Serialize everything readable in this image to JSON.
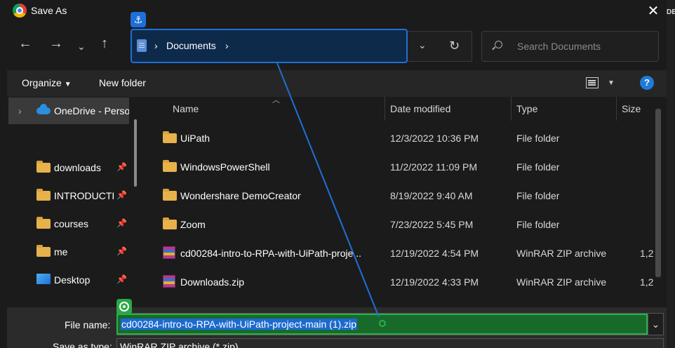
{
  "window": {
    "title": "Save As",
    "close_icon": "close-icon",
    "edge_text": "DE"
  },
  "nav": {
    "back_icon": "arrow-left-icon",
    "forward_icon": "arrow-right-icon",
    "recent_icon": "chevron-down-icon",
    "up_icon": "arrow-up-icon",
    "breadcrumb": [
      "Documents"
    ],
    "refresh_icon": "refresh-icon",
    "search_placeholder": "Search Documents"
  },
  "toolbar": {
    "organize": "Organize",
    "new_folder": "New folder"
  },
  "sidebar": {
    "items": [
      {
        "label": "OneDrive - Perso",
        "icon": "onedrive-icon",
        "pinned": false
      },
      {
        "label": "downloads",
        "icon": "folder-icon",
        "pinned": true
      },
      {
        "label": "INTRODUCTI",
        "icon": "folder-icon",
        "pinned": true
      },
      {
        "label": "courses",
        "icon": "folder-icon",
        "pinned": true
      },
      {
        "label": "me",
        "icon": "folder-icon",
        "pinned": true
      },
      {
        "label": "Desktop",
        "icon": "desktop-icon",
        "pinned": true
      }
    ]
  },
  "columns": {
    "name": "Name",
    "date": "Date modified",
    "type": "Type",
    "size": "Size"
  },
  "files": [
    {
      "name": "UiPath",
      "date": "12/3/2022 10:36 PM",
      "type": "File folder",
      "size": "",
      "icon": "folder-icon"
    },
    {
      "name": "WindowsPowerShell",
      "date": "11/2/2022 11:09 PM",
      "type": "File folder",
      "size": "",
      "icon": "folder-icon"
    },
    {
      "name": "Wondershare DemoCreator",
      "date": "8/19/2022 9:40 AM",
      "type": "File folder",
      "size": "",
      "icon": "folder-icon"
    },
    {
      "name": "Zoom",
      "date": "7/23/2022 5:45 PM",
      "type": "File folder",
      "size": "",
      "icon": "folder-icon"
    },
    {
      "name": "cd00284-intro-to-RPA-with-UiPath-proje...",
      "date": "12/19/2022 4:54 PM",
      "type": "WinRAR ZIP archive",
      "size": "1,2",
      "icon": "zip-icon"
    },
    {
      "name": "Downloads.zip",
      "date": "12/19/2022 4:33 PM",
      "type": "WinRAR ZIP archive",
      "size": "1,2",
      "icon": "zip-icon"
    }
  ],
  "form": {
    "file_name_label": "File name:",
    "file_name_value": "cd00284-intro-to-RPA-with-UiPath-project-main (1).zip",
    "save_type_label": "Save as type:",
    "save_type_value": "WinRAR ZIP archive (*.zip)"
  },
  "colors": {
    "accent": "#1f6fd8",
    "target_green": "#2bb04a"
  }
}
